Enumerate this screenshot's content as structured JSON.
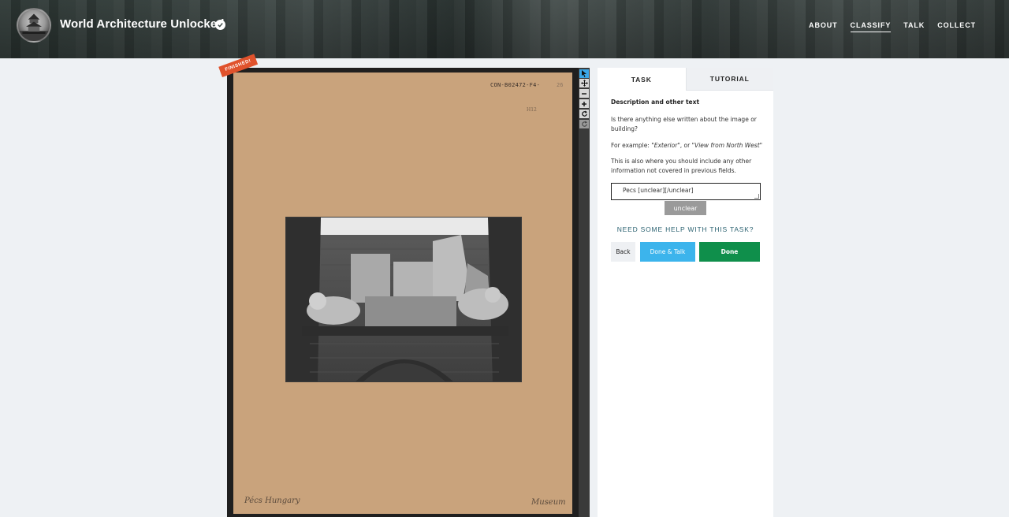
{
  "header": {
    "title": "World Architecture Unlocked",
    "verified_icon": "check-circle-icon",
    "nav": [
      {
        "label": "ABOUT",
        "active": false
      },
      {
        "label": "CLASSIFY",
        "active": true
      },
      {
        "label": "TALK",
        "active": false
      },
      {
        "label": "COLLECT",
        "active": false
      }
    ]
  },
  "viewer": {
    "badge": "FINISHED!",
    "card_reference": "CON-B02472-F4-",
    "card_reference_suffix": "26",
    "card_small_note": "H12",
    "card_handwriting_left": "Pécs   Hungary",
    "card_handwriting_right": "Museum",
    "tools": [
      "pointer-icon",
      "move-icon",
      "zoom-out-icon",
      "zoom-in-icon",
      "rotate-icon",
      "reset-icon"
    ]
  },
  "panel": {
    "tabs": [
      {
        "label": "TASK",
        "active": true
      },
      {
        "label": "TUTORIAL",
        "active": false
      }
    ],
    "task_title": "Description and other text",
    "question": "Is there anything else written about the image or building?",
    "example_prefix": "For example: ",
    "example_1": "\"Exterior\"",
    "example_mid": ", or ",
    "example_2": "\"View from North West\"",
    "info": "This is also where you should include any other information not covered in previous fields.",
    "answer_value": "Pecs [unclear][/unclear]",
    "unclear_button": "unclear",
    "help_link": "NEED SOME HELP WITH THIS TASK?",
    "back_button": "Back",
    "done_talk_button": "Done & Talk",
    "done_button": "Done"
  },
  "colors": {
    "accent_blue": "#3cb4ec",
    "done_green": "#0f8f4b",
    "finished_badge": "#e0522c",
    "card_tan": "#c9a37c"
  }
}
